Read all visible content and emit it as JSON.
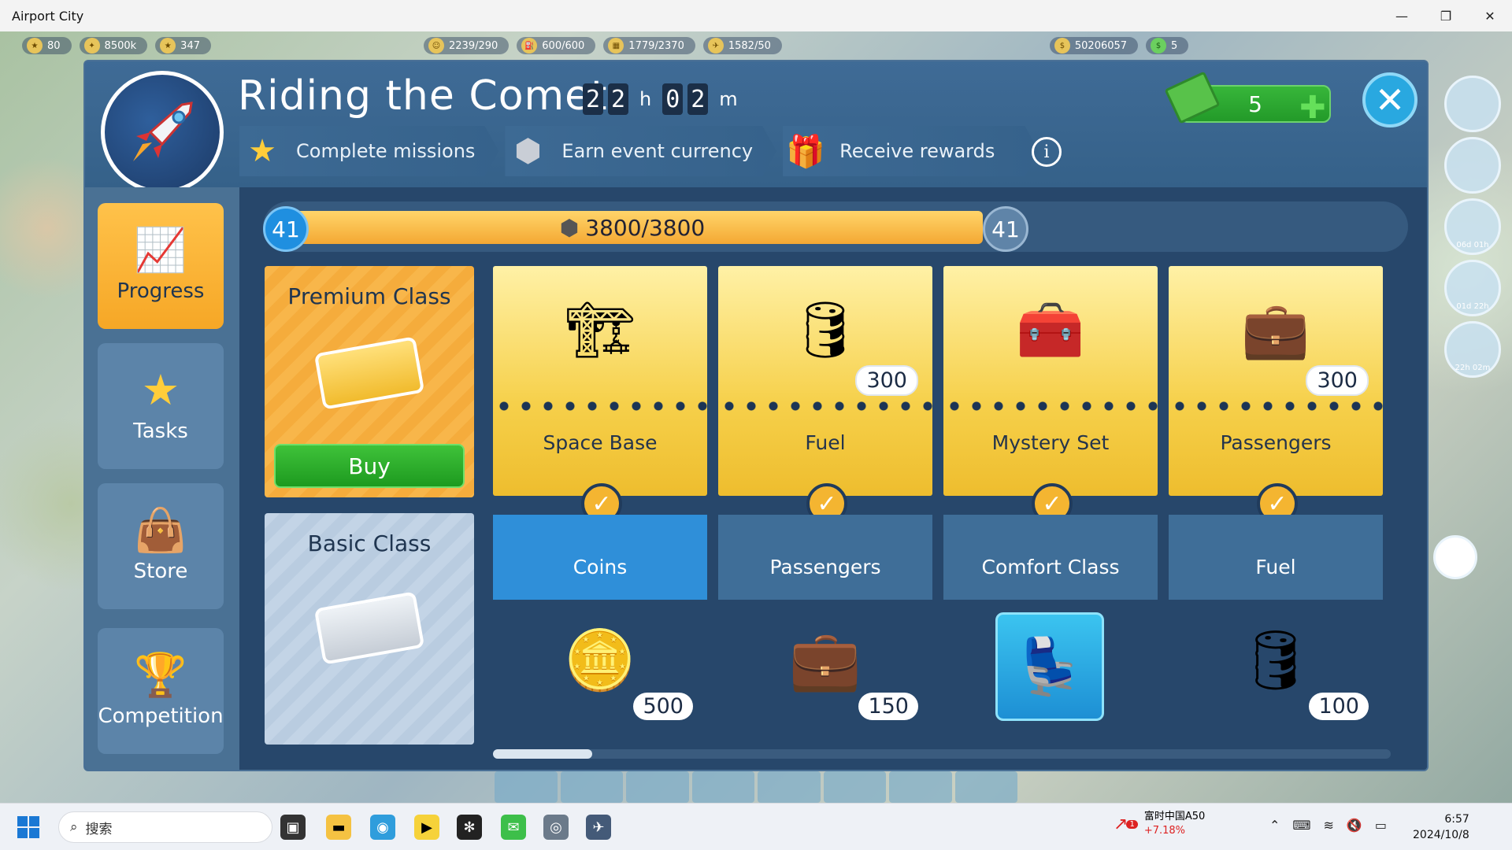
{
  "window": {
    "title": "Airport City"
  },
  "resources": [
    {
      "icon": "level-icon",
      "value": "80"
    },
    {
      "icon": "xp-icon",
      "value": "8500k"
    },
    {
      "icon": "star-icon",
      "value": "347"
    },
    {
      "icon": "passengers-icon",
      "value": "2239/290"
    },
    {
      "icon": "fuel-icon",
      "value": "600/600"
    },
    {
      "icon": "building-icon",
      "value": "1779/2370"
    },
    {
      "icon": "cargo-icon",
      "value": "1582/50"
    },
    {
      "icon": "coins-icon",
      "value": "50206057"
    },
    {
      "icon": "cash-icon",
      "value": "5"
    }
  ],
  "side_widgets": [
    {
      "label": "06d 01h"
    },
    {
      "label": "01d 22h"
    },
    {
      "label": "22h 02m"
    }
  ],
  "event": {
    "title": "Riding the Comet",
    "timer": {
      "h_digits": [
        "2",
        "2"
      ],
      "h_unit": "h",
      "m_digits": [
        "0",
        "2"
      ],
      "m_unit": "m"
    },
    "steps": [
      {
        "icon": "star-icon",
        "label": "Complete missions"
      },
      {
        "icon": "meteor-icon",
        "label": "Earn event currency"
      },
      {
        "icon": "gift-icon",
        "label": "Receive rewards"
      }
    ],
    "info_label": "i",
    "cash": {
      "value": "5"
    }
  },
  "nav": [
    {
      "label": "Progress",
      "icon": "chart-icon",
      "active": true
    },
    {
      "label": "Tasks",
      "icon": "star-icon",
      "active": false
    },
    {
      "label": "Store",
      "icon": "shopping-bag-icon",
      "active": false
    },
    {
      "label": "Competition",
      "icon": "trophy-icon",
      "active": false
    }
  ],
  "progress": {
    "current_level": "41",
    "next_level": "41",
    "label": "3800/3800",
    "fraction": 1.0
  },
  "tracks": {
    "premium": {
      "label": "Premium Class",
      "buy_label": "Buy"
    },
    "basic": {
      "label": "Basic Class"
    }
  },
  "columns": [
    {
      "premium_name": "Space Base",
      "premium_qty": "",
      "premium_icon": "space-base-icon",
      "basic_name": "Coins",
      "basic_qty": "500",
      "basic_icon": "coins-icon",
      "basic_selected": true
    },
    {
      "premium_name": "Fuel",
      "premium_qty": "300",
      "premium_icon": "fuel-barrel-icon",
      "basic_name": "Passengers",
      "basic_qty": "150",
      "basic_icon": "suitcase-icon",
      "basic_selected": false
    },
    {
      "premium_name": "Mystery Set",
      "premium_qty": "",
      "premium_icon": "mystery-chest-icon",
      "basic_name": "Comfort Class",
      "basic_qty": "",
      "basic_icon": "seat-icon",
      "basic_selected": false
    },
    {
      "premium_name": "Passengers",
      "premium_qty": "300",
      "premium_icon": "suitcase-icon",
      "basic_name": "Fuel",
      "basic_qty": "100",
      "basic_icon": "oil-barrel-icon",
      "basic_selected": false
    }
  ],
  "taskbar": {
    "search_placeholder": "搜索",
    "stock_name": "富时中国A50",
    "stock_change": "+7.18%",
    "stock_badge": "1",
    "time": "6:57",
    "date": "2024/10/8"
  },
  "colors": {
    "panel": "#2f4e70",
    "accent_gold": "#f4b531",
    "accent_blue": "#2f8fd9",
    "buy_green": "#2aa82a"
  }
}
